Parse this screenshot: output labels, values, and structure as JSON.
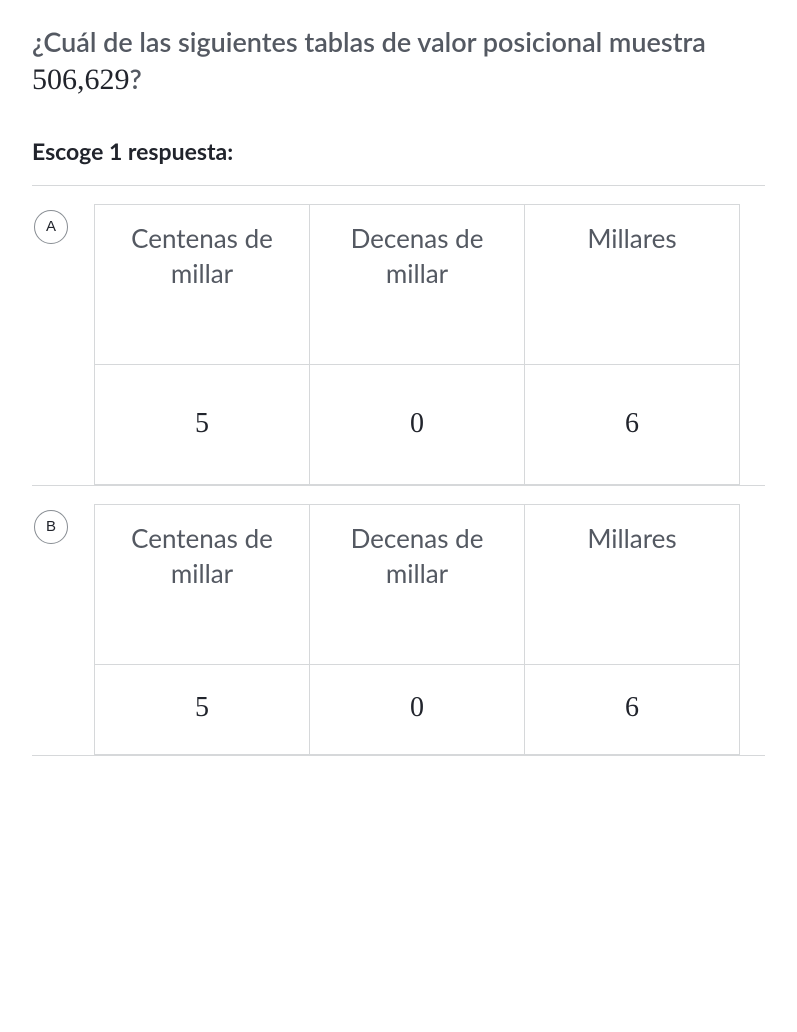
{
  "question": {
    "prefix": "¿Cuál de las siguientes tablas de valor posicional muestra ",
    "number": "506,629",
    "suffix": "?"
  },
  "instruction": "Escoge 1 respuesta:",
  "choices": [
    {
      "letter": "A",
      "headers": [
        "Centenas de millar",
        "Decenas de millar",
        "Millares"
      ],
      "values": [
        "5",
        "0",
        "6"
      ]
    },
    {
      "letter": "B",
      "headers": [
        "Centenas de millar",
        "Decenas de millar",
        "Millares"
      ],
      "values": [
        "5",
        "0",
        "6"
      ]
    }
  ]
}
